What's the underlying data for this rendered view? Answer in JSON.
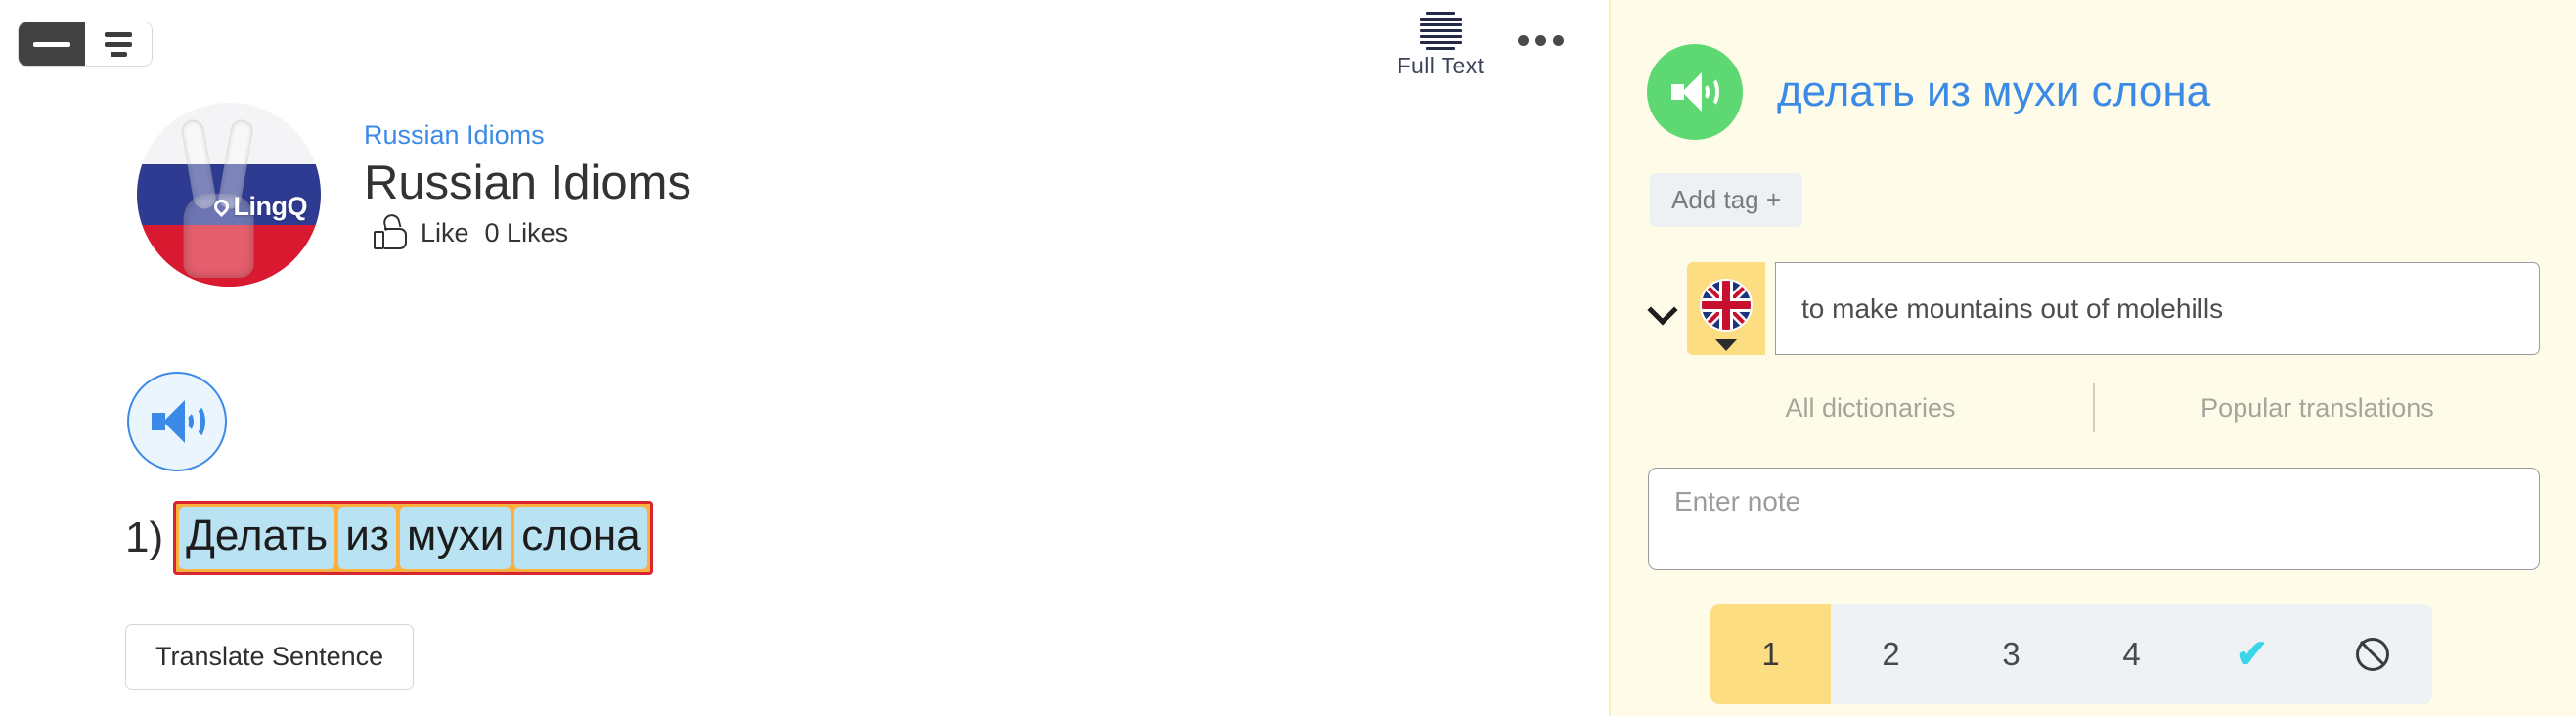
{
  "reader": {
    "view_toggle": {
      "name": "view-mode-toggle",
      "left_mode": "sentence-view",
      "right_mode": "page-view"
    },
    "full_text": {
      "label": "Full Text"
    },
    "more_menu": {
      "label": "..."
    },
    "course": {
      "breadcrumb": "Russian Idioms",
      "title": "Russian Idioms",
      "like_label": "Like",
      "likes_count": "0 Likes",
      "avatar_brand": "LingQ"
    },
    "sentence": {
      "number": "1)",
      "words": [
        "Делать",
        "из",
        "мухи",
        "слона"
      ],
      "phrase_border_color": "#d9232e",
      "phrase_bg_color": "#fbb040",
      "word_bg_color": "#b9e2f2"
    },
    "translate_button": "Translate Sentence"
  },
  "widget": {
    "term": "делать из мухи слона",
    "play_color": "#5ed873",
    "add_tag": "Add tag +",
    "translation": {
      "language_flag": "uk-flag",
      "value": "to make mountains out of molehills",
      "add_button": "+"
    },
    "tabs": [
      {
        "label": "All dictionaries"
      },
      {
        "label": "Popular translations"
      }
    ],
    "note": {
      "placeholder": "Enter note",
      "value": ""
    },
    "levels": {
      "items": [
        "1",
        "2",
        "3",
        "4"
      ],
      "known_icon": "✔",
      "ignore_icon": "ban",
      "selected": "1",
      "selected_color": "#fcdd82"
    }
  }
}
